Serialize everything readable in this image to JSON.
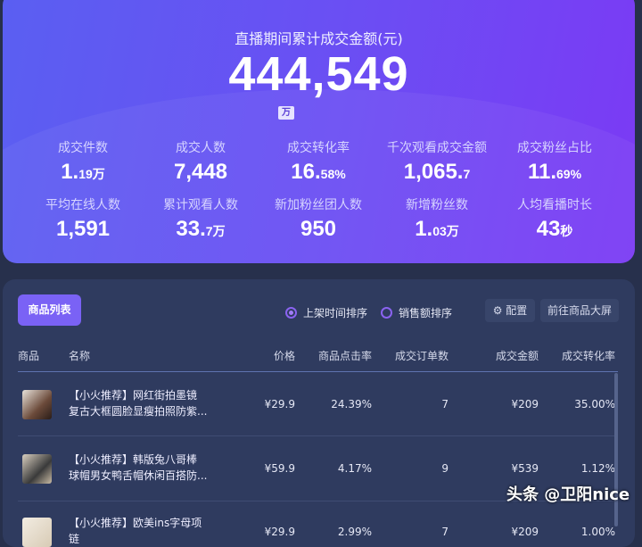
{
  "header": {
    "title": "直播期间累计成交金额(元)",
    "total": "444,549",
    "unit": "万"
  },
  "stats": [
    {
      "label": "成交件数",
      "int": "1.",
      "dec": "19万"
    },
    {
      "label": "成交人数",
      "int": "7,448",
      "dec": ""
    },
    {
      "label": "成交转化率",
      "int": "16.",
      "dec": "58%"
    },
    {
      "label": "千次观看成交金额",
      "int": "1,065.",
      "dec": "7"
    },
    {
      "label": "成交粉丝占比",
      "int": "11.",
      "dec": "69%"
    },
    {
      "label": "平均在线人数",
      "int": "1,591",
      "dec": ""
    },
    {
      "label": "累计观看人数",
      "int": "33.",
      "dec": "7万"
    },
    {
      "label": "新加粉丝团人数",
      "int": "950",
      "dec": ""
    },
    {
      "label": "新增粉丝数",
      "int": "1.",
      "dec": "03万"
    },
    {
      "label": "人均看播时长",
      "int": "43",
      "dec": "秒"
    }
  ],
  "panel": {
    "list_button": "商品列表",
    "sort_time": "上架时间排序",
    "sort_sales": "销售额排序",
    "config": "配置",
    "goto_screen": "前往商品大屏"
  },
  "columns": [
    "商品",
    "名称",
    "价格",
    "商品点击率",
    "成交订单数",
    "成交金额",
    "成交转化率"
  ],
  "rows": [
    {
      "name1": "【小火推荐】网红街拍墨镜",
      "name2": "复古大框圆脸显瘦拍照防紫...",
      "price": "¥29.9",
      "ctr": "24.39%",
      "orders": "7",
      "amount": "¥209",
      "cvr": "35.00%"
    },
    {
      "name1": "【小火推荐】韩版兔八哥棒",
      "name2": "球帽男女鸭舌帽休闲百搭防...",
      "price": "¥59.9",
      "ctr": "4.17%",
      "orders": "9",
      "amount": "¥539",
      "cvr": "1.12%"
    },
    {
      "name1": "【小火推荐】欧美ins字母项",
      "name2": "链",
      "price": "¥29.9",
      "ctr": "2.99%",
      "orders": "7",
      "amount": "¥209",
      "cvr": "1.00%"
    }
  ],
  "watermark": "头条 @卫阳nice"
}
